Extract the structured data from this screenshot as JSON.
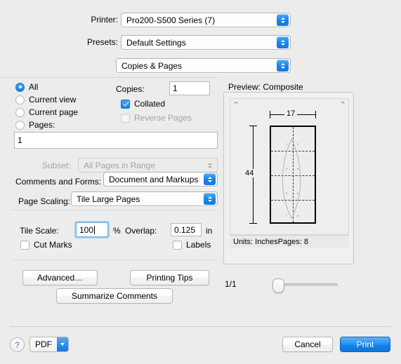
{
  "window": {
    "title": "Print"
  },
  "printer": {
    "label": "Printer:",
    "value": "Pro200-S500 Series (7)"
  },
  "presets": {
    "label": "Presets:",
    "value": "Default Settings"
  },
  "pane": {
    "value": "Copies & Pages"
  },
  "range": {
    "options": [
      {
        "label": "All",
        "selected": true
      },
      {
        "label": "Current view",
        "selected": false
      },
      {
        "label": "Current page",
        "selected": false
      },
      {
        "label": "Pages:",
        "selected": false
      }
    ],
    "pages_value": "1"
  },
  "copies": {
    "label": "Copies:",
    "value": "1",
    "collated_label": "Collated",
    "collated_checked": true,
    "reverse_label": "Reverse Pages",
    "reverse_checked": false,
    "reverse_disabled": true
  },
  "subset": {
    "label": "Subset:",
    "value": "All Pages in Range",
    "disabled": true
  },
  "comments": {
    "label": "Comments and Forms:",
    "value": "Document and Markups"
  },
  "page_scaling": {
    "label": "Page Scaling:",
    "value": "Tile Large Pages"
  },
  "tile": {
    "scale_label": "Tile Scale:",
    "scale_value": "100",
    "percent_unit": "%",
    "overlap_label": "Overlap:",
    "overlap_value": "0.125",
    "overlap_unit": "in",
    "cut_marks_label": "Cut Marks",
    "cut_marks_checked": false,
    "labels_label": "Labels",
    "labels_checked": false
  },
  "preview": {
    "title": "Preview: Composite",
    "width_dim": "17",
    "height_dim": "44",
    "units_text": "Units: InchesPages: 8",
    "page_indicator": "1/1",
    "tile_numbers": [
      "1",
      "2",
      "3",
      "4",
      "5",
      "6",
      "7",
      "8"
    ]
  },
  "buttons": {
    "advanced": "Advanced…",
    "printing_tips": "Printing Tips",
    "summarize": "Summarize Comments",
    "help": "?",
    "pdf": "PDF",
    "cancel": "Cancel",
    "print": "Print"
  },
  "colors": {
    "accent_blue": "#1680ea",
    "window_bg": "#ececec",
    "print_button": "#1580ea"
  }
}
